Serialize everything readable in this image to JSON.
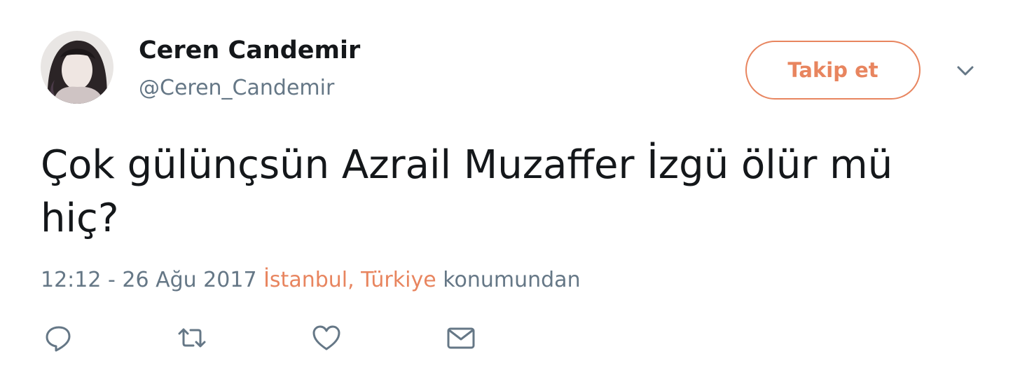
{
  "user": {
    "display_name": "Ceren Candemir",
    "handle": "@Ceren_Candemir"
  },
  "follow_button": {
    "label": "Takip et"
  },
  "tweet": {
    "text_line1": "Çok gülünçsün Azrail Muzaffer İzgü ölür mü",
    "text_line2": "hiç?",
    "timestamp": "12:12 - 26 Ağu 2017",
    "location": "İstanbul, Türkiye",
    "location_suffix": "konumundan"
  },
  "actions": [
    {
      "icon": "reply-icon"
    },
    {
      "icon": "retweet-icon"
    },
    {
      "icon": "like-icon"
    },
    {
      "icon": "direct-message-icon"
    }
  ],
  "colors": {
    "accent": "#e8855f",
    "text": "#14171a",
    "secondary_text": "#657786"
  }
}
